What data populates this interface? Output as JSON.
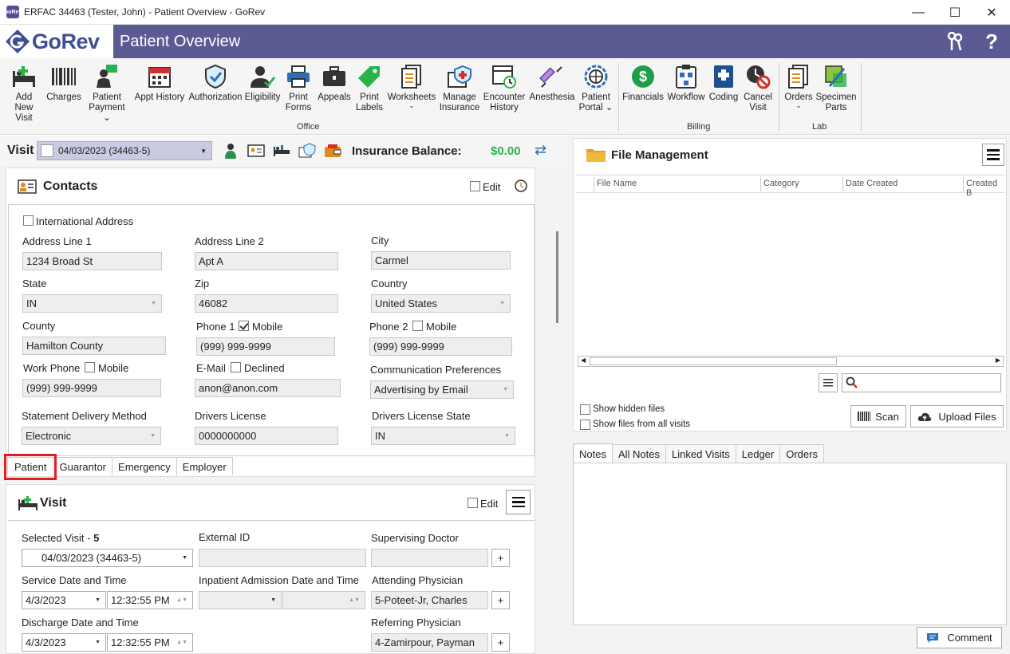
{
  "window": {
    "title": "ERFAC 34463 (Tester, John) - Patient Overview - GoRev",
    "app_icon_text": "GoRev",
    "minimize": "—",
    "maximize": "☐",
    "close": "✕"
  },
  "brand": {
    "logo_text": "GoRev",
    "page_title": "Patient Overview",
    "help_icon": "?"
  },
  "ribbon": {
    "office_buttons": [
      {
        "label1": "Add New",
        "label2": "Visit"
      },
      {
        "label1": "Charges",
        "label2": ""
      },
      {
        "label1": "Patient",
        "label2": "Payment ⌄"
      },
      {
        "label1": "Appt History",
        "label2": ""
      },
      {
        "label1": "Authorization",
        "label2": ""
      },
      {
        "label1": "Eligibility",
        "label2": ""
      },
      {
        "label1": "Print",
        "label2": "Forms"
      },
      {
        "label1": "Appeals",
        "label2": ""
      },
      {
        "label1": "Print",
        "label2": "Labels"
      },
      {
        "label1": "Worksheets",
        "label2": "⌄"
      },
      {
        "label1": "Manage",
        "label2": "Insurance"
      },
      {
        "label1": "Encounter",
        "label2": "History"
      },
      {
        "label1": "Anesthesia",
        "label2": ""
      },
      {
        "label1": "Patient",
        "label2": "Portal ⌄"
      }
    ],
    "billing_buttons": [
      {
        "label1": "Financials",
        "label2": ""
      },
      {
        "label1": "Workflow",
        "label2": ""
      },
      {
        "label1": "Coding",
        "label2": ""
      },
      {
        "label1": "Cancel",
        "label2": "Visit"
      }
    ],
    "lab_buttons": [
      {
        "label1": "Orders",
        "label2": "⌄"
      },
      {
        "label1": "Specimen",
        "label2": "Parts"
      }
    ],
    "groups": {
      "office": "Office",
      "billing": "Billing",
      "lab": "Lab"
    },
    "financials_symbol": "$"
  },
  "visit_bar": {
    "label": "Visit",
    "selected": "04/03/2023 (34463-5)",
    "insurance_balance_label": "Insurance Balance:",
    "insurance_balance_value": "$0.00",
    "refresh_glyph": "⇄"
  },
  "contacts": {
    "title": "Contacts",
    "edit_label": "Edit",
    "international_address_label": "International Address",
    "fields": {
      "address1": {
        "label": "Address Line 1",
        "value": "1234 Broad St"
      },
      "address2": {
        "label": "Address Line 2",
        "value": "Apt A"
      },
      "city": {
        "label": "City",
        "value": "Carmel"
      },
      "state": {
        "label": "State",
        "value": "IN"
      },
      "zip": {
        "label": "Zip",
        "value": "46082"
      },
      "country": {
        "label": "Country",
        "value": "United States"
      },
      "county": {
        "label": "County",
        "value": "Hamilton County"
      },
      "phone1": {
        "label": "Phone 1",
        "mobile_label": "Mobile",
        "value": "(999) 999-9999"
      },
      "phone2": {
        "label": "Phone 2",
        "mobile_label": "Mobile",
        "value": "(999) 999-9999"
      },
      "work_phone": {
        "label": "Work Phone",
        "mobile_label": "Mobile",
        "value": "(999) 999-9999"
      },
      "email": {
        "label": "E-Mail",
        "declined_label": "Declined",
        "value": "anon@anon.com"
      },
      "comm_pref": {
        "label": "Communication Preferences",
        "value": "Advertising by Email"
      },
      "statement_delivery": {
        "label": "Statement Delivery Method",
        "value": "Electronic"
      },
      "drivers_license": {
        "label": "Drivers License",
        "value": "0000000000"
      },
      "drivers_license_state": {
        "label": "Drivers License State",
        "value": "IN"
      }
    },
    "tabs": [
      "Patient",
      "Guarantor",
      "Emergency",
      "Employer"
    ]
  },
  "visit_section": {
    "title": "Visit",
    "edit_label": "Edit",
    "selected_visit_label": "Selected Visit -",
    "selected_visit_num": "5",
    "selected_visit_value": "04/03/2023 (34463-5)",
    "external_id_label": "External ID",
    "supervising_label": "Supervising Doctor",
    "service_label": "Service Date and Time",
    "service_date": "4/3/2023",
    "service_time": "12:32:55 PM",
    "inpatient_label": "Inpatient Admission Date and Time",
    "attending_label": "Attending Physician",
    "attending_value": "5-Poteet-Jr, Charles",
    "discharge_label": "Discharge Date and Time",
    "discharge_date": "4/3/2023",
    "discharge_time": "12:32:55 PM",
    "referring_label": "Referring Physician",
    "referring_value": "4-Zamirpour, Payman",
    "add_glyph": "+"
  },
  "file_management": {
    "title": "File Management",
    "columns": [
      "File Name",
      "Category",
      "Date Created",
      "Created B"
    ],
    "show_hidden": "Show hidden files",
    "show_all": "Show files from all visits",
    "scan": "Scan",
    "upload": "Upload Files"
  },
  "notes": {
    "tabs": [
      "Notes",
      "All Notes",
      "Linked Visits",
      "Ledger",
      "Orders"
    ],
    "comment_label": "Comment"
  },
  "colors": {
    "brand": "#5c5a93",
    "accent_green": "#2bb24c",
    "highlight": "#e01c24"
  }
}
